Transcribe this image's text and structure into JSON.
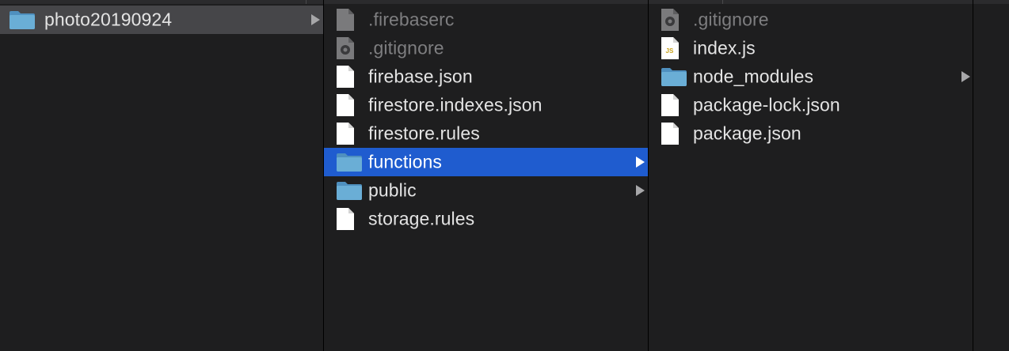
{
  "columns": [
    {
      "items": [
        {
          "name": "photo20190924",
          "kind": "folder",
          "has_children": true,
          "state": "parent-selected"
        }
      ]
    },
    {
      "items": [
        {
          "name": ".firebaserc",
          "kind": "file-generic",
          "hidden": true
        },
        {
          "name": ".gitignore",
          "kind": "file-gear",
          "hidden": true
        },
        {
          "name": "firebase.json",
          "kind": "file"
        },
        {
          "name": "firestore.indexes.json",
          "kind": "file"
        },
        {
          "name": "firestore.rules",
          "kind": "file"
        },
        {
          "name": "functions",
          "kind": "folder",
          "has_children": true,
          "state": "selected"
        },
        {
          "name": "public",
          "kind": "folder",
          "has_children": true
        },
        {
          "name": "storage.rules",
          "kind": "file"
        }
      ]
    },
    {
      "items": [
        {
          "name": ".gitignore",
          "kind": "file-gear",
          "hidden": true
        },
        {
          "name": "index.js",
          "kind": "file-js",
          "badge": "JS"
        },
        {
          "name": "node_modules",
          "kind": "folder",
          "has_children": true
        },
        {
          "name": "package-lock.json",
          "kind": "file"
        },
        {
          "name": "package.json",
          "kind": "file"
        }
      ]
    }
  ],
  "colors": {
    "background": "#1e1e1f",
    "selection": "#1f5ccf",
    "parent_selection": "#464649",
    "folder": "#6aaed6",
    "text": "#e4e4e4",
    "hidden_text": "#7e7e80"
  }
}
